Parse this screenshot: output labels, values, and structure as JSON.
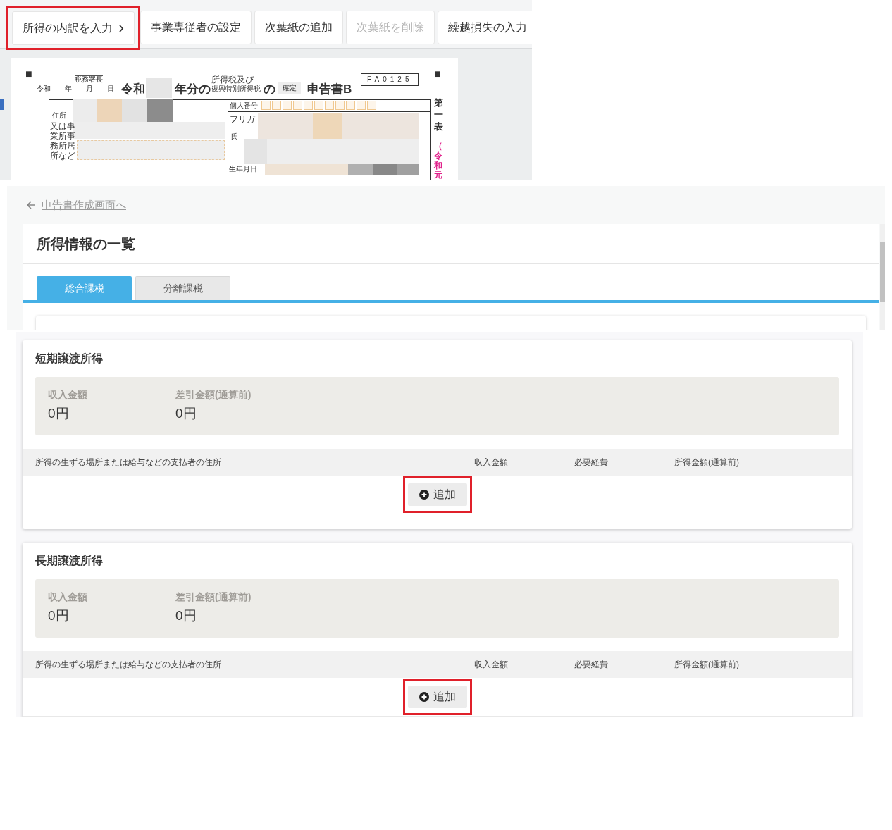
{
  "toolbar": {
    "buttons": [
      {
        "label": "所得の内訳を入力",
        "kind": "next",
        "disabled": false,
        "highlighted": true
      },
      {
        "label": "事業専従者の設定",
        "kind": "plain",
        "disabled": false,
        "highlighted": false
      },
      {
        "label": "次葉紙の追加",
        "kind": "plain",
        "disabled": false,
        "highlighted": false
      },
      {
        "label": "次葉紙を削除",
        "kind": "plain",
        "disabled": true,
        "highlighted": false
      },
      {
        "label": "繰越損失の入力",
        "kind": "plain",
        "disabled": false,
        "highlighted": false
      }
    ]
  },
  "form_preview": {
    "corner_mark": "■",
    "office_label": "税務署長",
    "date_label": "令和　　年　　月　　日",
    "era": "令和",
    "year_suffix": "年分の",
    "tax_name_top": "所得税及び",
    "tax_name_bottom": "復興特別所得税",
    "particle": "の",
    "return_type": "確定",
    "title": "申告書B",
    "form_code": "FA0125",
    "side_label": "第一表",
    "side_note": "（令和元",
    "fields": [
      "住所",
      "又は事業所事務所居所など",
      "個人番号",
      "フリガ",
      "氏",
      "生年月日"
    ]
  },
  "back_link": "申告書作成画面へ",
  "page_title": "所得情報の一覧",
  "tabs": [
    {
      "label": "総合課税",
      "selected": true
    },
    {
      "label": "分離課税",
      "selected": false
    }
  ],
  "sections": [
    {
      "title": "短期譲渡所得",
      "summary": [
        {
          "label": "収入金額",
          "value": "0円"
        },
        {
          "label": "差引金額(通算前)",
          "value": "0円"
        }
      ],
      "columns": [
        "所得の生ずる場所または給与などの支払者の住所",
        "収入金額",
        "必要経費",
        "所得金額(通算前)"
      ],
      "add_button": {
        "label": "追加",
        "highlighted": true
      }
    },
    {
      "title": "長期譲渡所得",
      "summary": [
        {
          "label": "収入金額",
          "value": "0円"
        },
        {
          "label": "差引金額(通算前)",
          "value": "0円"
        }
      ],
      "columns": [
        "所得の生ずる場所または給与などの支払者の住所",
        "収入金額",
        "必要経費",
        "所得金額(通算前)"
      ],
      "add_button": {
        "label": "追加",
        "highlighted": true
      }
    }
  ]
}
